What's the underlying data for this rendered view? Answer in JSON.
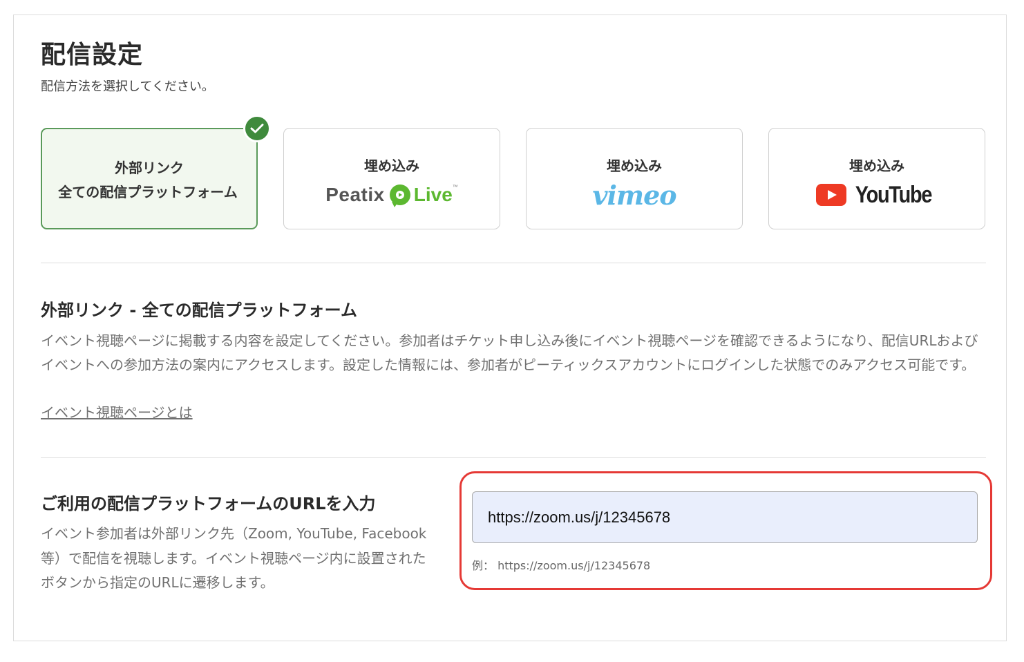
{
  "page": {
    "title": "配信設定",
    "subtitle": "配信方法を選択してください。"
  },
  "options": [
    {
      "label": "外部リンク",
      "sublabel": "全ての配信プラットフォーム",
      "selected": true
    },
    {
      "label": "埋め込み",
      "logo_text_1": "Peatix",
      "logo_text_2": "Live",
      "logo_mark": "™",
      "selected": false
    },
    {
      "label": "埋め込み",
      "logo_text_1": "vimeo",
      "selected": false
    },
    {
      "label": "埋め込み",
      "logo_text_1": "YouTube",
      "selected": false
    }
  ],
  "icons": {
    "selected_badge": "check-icon",
    "peatix": "peatix-live-icon",
    "youtube": "youtube-play-icon"
  },
  "colors": {
    "selected_border": "#5a9a5a",
    "selected_bg": "#f2f8ef",
    "check_badge": "#3f8a3c",
    "peatix_green": "#5cb830",
    "vimeo_blue": "#5bb7e6",
    "youtube_red": "#ee3a24",
    "highlight_red": "#e53935",
    "input_bg": "#e9eefc"
  },
  "external_section": {
    "title": "外部リンク - 全ての配信プラットフォーム",
    "description": "イベント視聴ページに掲載する内容を設定してください。参加者はチケット申し込み後にイベント視聴ページを確認できるようになり、配信URLおよびイベントへの参加方法の案内にアクセスします。設定した情報には、参加者がピーティックスアカウントにログインした状態でのみアクセス可能です。",
    "help_link": "イベント視聴ページとは"
  },
  "url_section": {
    "title": "ご利用の配信プラットフォームのURLを入力",
    "description": "イベント参加者は外部リンク先（Zoom, YouTube, Facebook等）で配信を視聴します。イベント視聴ページ内に設置されたボタンから指定のURLに遷移します。",
    "input_value": "https://zoom.us/j/12345678",
    "example": "例： https://zoom.us/j/12345678"
  }
}
